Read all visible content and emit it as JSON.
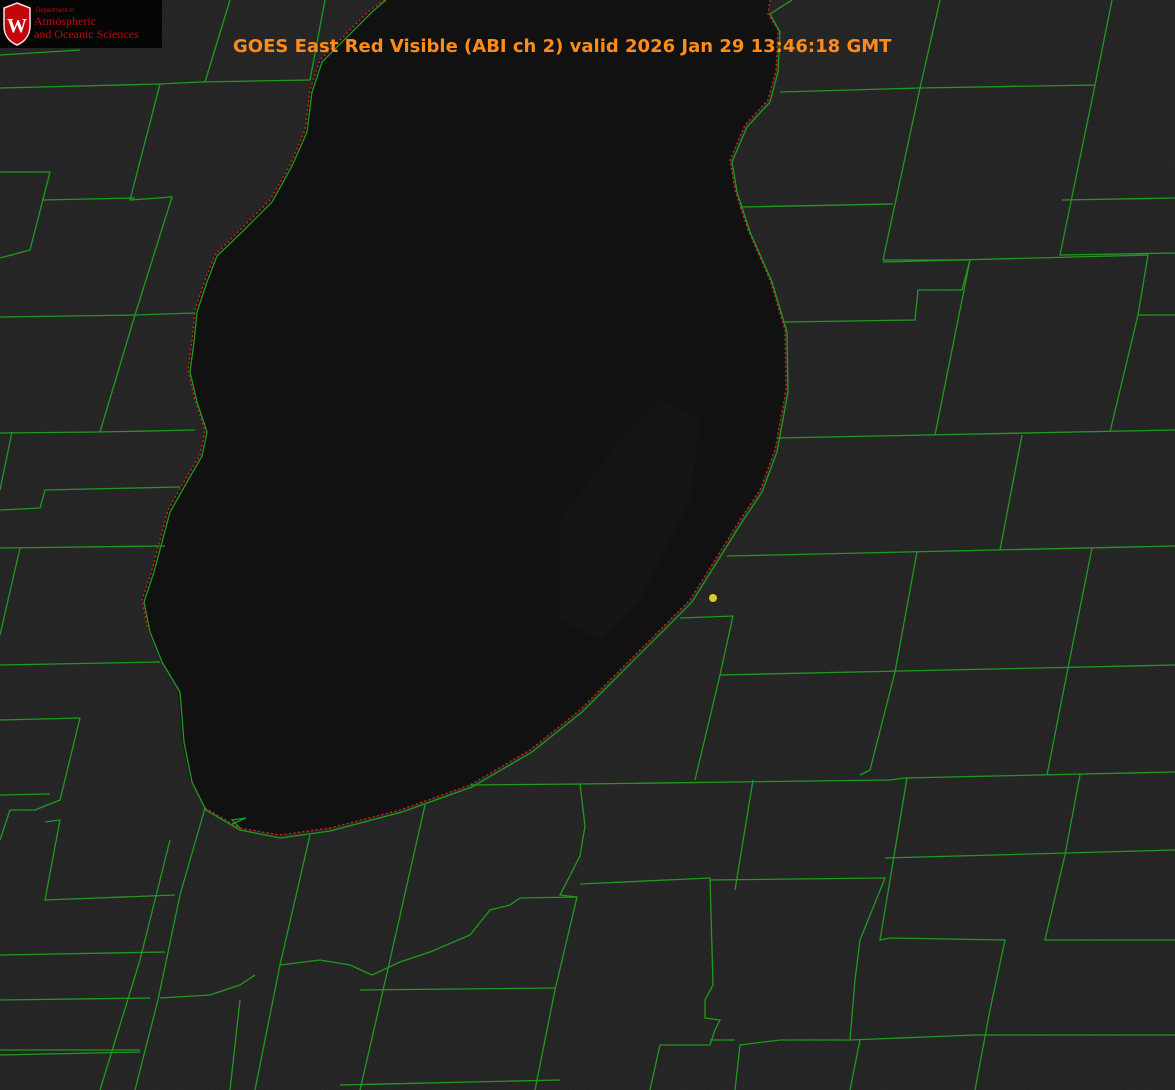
{
  "title": "GOES East Red Visible (ABI ch 2) valid 2026 Jan 29 13:46:18 GMT",
  "logo": {
    "department": "Department of",
    "line1": "Atmospheric",
    "line2": "and Oceanic Sciences",
    "crest_letter": "W"
  },
  "colors": {
    "title": "#ff8c1a",
    "county_lines": "#1f9a1f",
    "shoreline": "#d02020",
    "marker": "#d8d020",
    "lake": "#101010",
    "land": "#1e1e1e",
    "logo_red": "#c5050c"
  },
  "marker": {
    "label": "",
    "icon": "yellow-dot"
  }
}
